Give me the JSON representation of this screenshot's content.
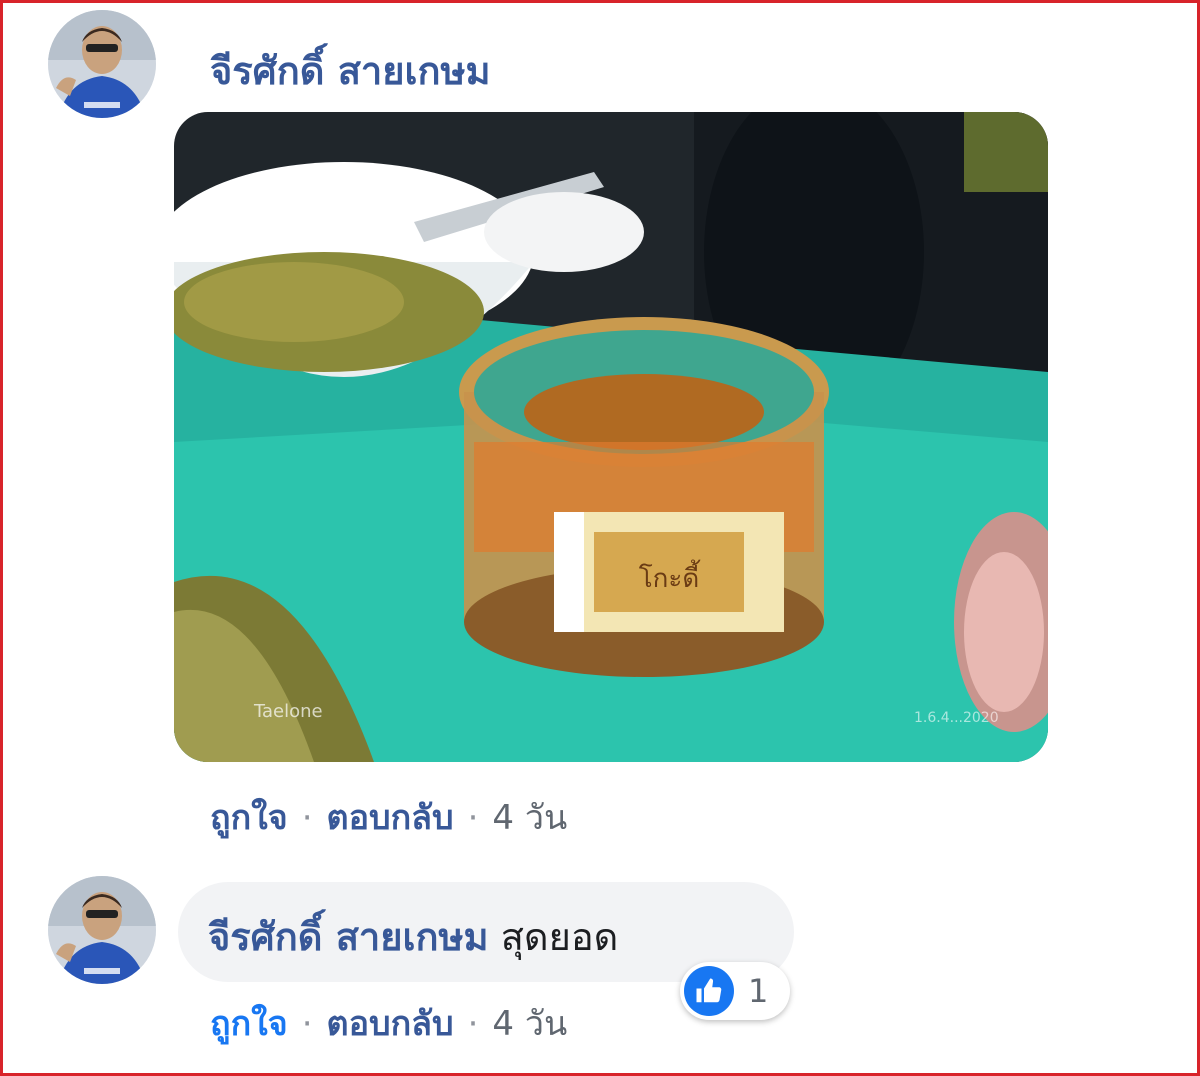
{
  "comments": [
    {
      "author": "จีรศักดิ์ สายเกษม",
      "photo": {
        "description_icon": "food-photo",
        "watermark_left": "Taelone",
        "watermark_right": "1.6.4...2020"
      },
      "actions": {
        "like": "ถูกใจ",
        "reply": "ตอบกลับ",
        "time": "4 วัน"
      }
    },
    {
      "author": "จีรศักดิ์ สายเกษม",
      "text": "สุดยอด",
      "reaction": {
        "icon": "like-icon",
        "count": "1"
      },
      "actions": {
        "like": "ถูกใจ",
        "reply": "ตอบกลับ",
        "time": "4 วัน"
      }
    }
  ],
  "colors": {
    "frame": "#d8232a",
    "name": "#385898",
    "like_blue": "#1877f2",
    "bubble": "#f2f3f5"
  }
}
